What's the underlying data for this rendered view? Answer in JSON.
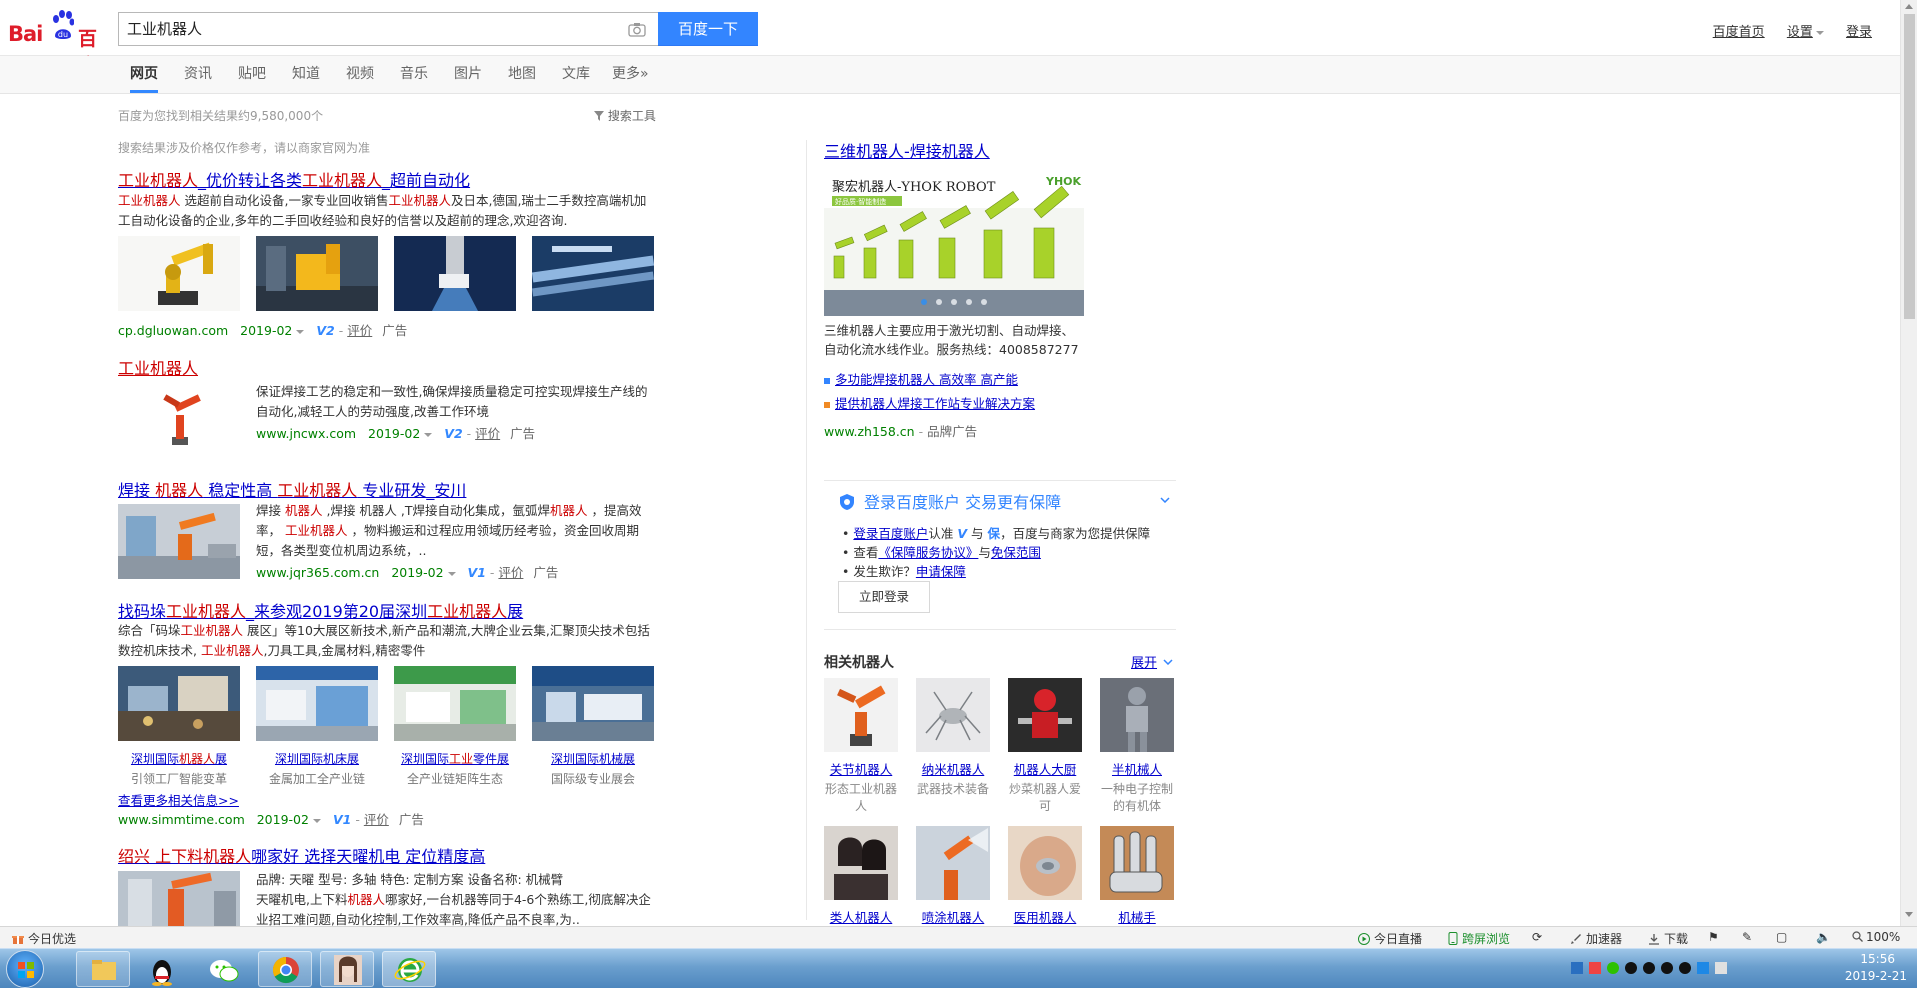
{
  "header": {
    "logo_text_left": "Bai",
    "logo_text_right": "百度",
    "search_value": "工业机器人",
    "search_button": "百度一下",
    "links": [
      "百度首页",
      "设置",
      "登录"
    ]
  },
  "tabs": [
    "网页",
    "资讯",
    "贴吧",
    "知道",
    "视频",
    "音乐",
    "图片",
    "地图",
    "文库",
    "更多»"
  ],
  "result_count": "百度为您找到相关结果约9,580,000个",
  "search_tools": "搜索工具",
  "price_notice": "搜索结果涉及价格仅作参考，请以商家官网为准",
  "results": [
    {
      "title_parts": [
        "工业机器人",
        "_优价转让各类",
        "工业机器人",
        "_超前自动化"
      ],
      "abstract_parts": [
        "工业机器人",
        " 选超前自动化设备,一家专业回收销售",
        "工业机器人",
        "及日本,德国,瑞士二手数控高端机加工自动化设备的企业,多年的二手回收经验和良好的信誉以及超前的理念,欢迎咨询."
      ],
      "url": "cp.dgluowan.com",
      "date": "2019-02",
      "vip": "V2",
      "rate": "评价",
      "ad": "广告"
    },
    {
      "title": "工业机器人",
      "abstract": "保证焊接工艺的稳定和一致性,确保焊接质量稳定可控实现焊接生产线的自动化,减轻工人的劳动强度,改善工作环境",
      "url": "www.jncwx.com",
      "date": "2019-02",
      "vip": "V2",
      "rate": "评价",
      "ad": "广告"
    },
    {
      "title_parts": [
        "焊接 ",
        "机器人",
        " 稳定性高 ",
        "工业机器人",
        " 专业研发_安川"
      ],
      "abstract_parts": [
        "焊接 ",
        "机器人",
        " ,焊接 机器人 ,T焊接自动化集成，氩弧焊",
        "机器人",
        " ，提高效率， ",
        "工业机器人",
        " ，物料搬运和过程应用领域历经考验，资金回收周期短，各类型变位机周边系统，.."
      ],
      "url": "www.jqr365.com.cn",
      "date": "2019-02",
      "vip": "V1",
      "rate": "评价",
      "ad": "广告"
    },
    {
      "title_parts": [
        "找码垛",
        "工业机器人",
        "_来参观2019第20届深圳",
        "工业机器人",
        "展"
      ],
      "abstract_parts": [
        "综合「码垛",
        "工业机器人",
        " 展区」等10大展区新技术,新产品和潮流,大牌企业云集,汇聚顶尖技术包括数控机床技术, ",
        "工业机器人",
        ",刀具工具,金属材料,精密零件"
      ],
      "thumbs": [
        {
          "cap": [
            "深圳国际",
            "机器人",
            "展"
          ],
          "sub": "引领工厂智能变革"
        },
        {
          "cap": [
            "深圳国际机床展"
          ],
          "sub": "金属加工全产业链"
        },
        {
          "cap": [
            "深圳国际",
            "工业",
            "零件展"
          ],
          "sub": "全产业链矩阵生态"
        },
        {
          "cap": [
            "深圳国际机械展"
          ],
          "sub": "国际级专业展会"
        }
      ],
      "more": "查看更多相关信息>>",
      "url": "www.simmtime.com",
      "date": "2019-02",
      "vip": "V1",
      "rate": "评价",
      "ad": "广告"
    },
    {
      "title_parts": [
        "绍兴 上下料",
        "机器人",
        "哪家好 选择天曜机电 定位精度高"
      ],
      "spec": "品牌: 天曜    型号: 多轴    特色: 定制方案    设备名称: 机械臂",
      "abstract_parts": [
        "天曜机电,上下料",
        "机器人",
        "哪家好,一台机器等同于4-6个熟练工,彻底解决企业招工难问题,自动化控制,工作效率高,降低产品不良率,为.."
      ]
    }
  ],
  "right_ad": {
    "title": "三维机器人-焊接机器人",
    "banner_text": "聚宏机器人-YHOK ROBOT",
    "banner_brand": "YHOK",
    "banner_tag": "好品质·智能制造",
    "desc": "三维机器人主要应用于激光切割、自动焊接、自动化流水线作业。服务热线：4008587277",
    "links": [
      "多功能焊接机器人 高效率 高产能",
      "提供机器人焊接工作站专业解决方案"
    ],
    "url": "www.zh158.cn",
    "ad": "品牌广告"
  },
  "login_card": {
    "heading": "登录百度账户  交易更有保障",
    "line1_link": "登录百度账户",
    "line1_mid": "认准",
    "line1_v": "V",
    "line1_and": "与",
    "line1_bao": "保",
    "line1_rest": "，百度与商家为您提供保障",
    "line2_pre": "查看",
    "line2_link1": "《保障服务协议》",
    "line2_and": "与",
    "line2_link2": "免保范围",
    "line3_pre": "发生欺诈？",
    "line3_link": "申请保障",
    "button": "立即登录"
  },
  "related": {
    "title": "相关机器人",
    "expand": "展开",
    "items": [
      {
        "name": "关节机器人",
        "sub": "形态工业机器人"
      },
      {
        "name": "纳米机器人",
        "sub": "武器技术装备"
      },
      {
        "name": "机器人大厨",
        "sub": "炒菜机器人爱可"
      },
      {
        "name": "半机械人",
        "sub": "一种电子控制的有机体"
      },
      {
        "name": "类人机器人",
        "sub": ""
      },
      {
        "name": "喷涂机器人",
        "sub": ""
      },
      {
        "name": "医用机器人",
        "sub": ""
      },
      {
        "name": "机械手",
        "sub": ""
      }
    ]
  },
  "statusbar": {
    "left": "今日优选",
    "items": [
      "今日直播",
      "跨屏浏览",
      "加速器",
      "下载"
    ],
    "zoom": "100%"
  },
  "taskbar": {
    "time": "15:56",
    "date": "2019-2-21"
  }
}
